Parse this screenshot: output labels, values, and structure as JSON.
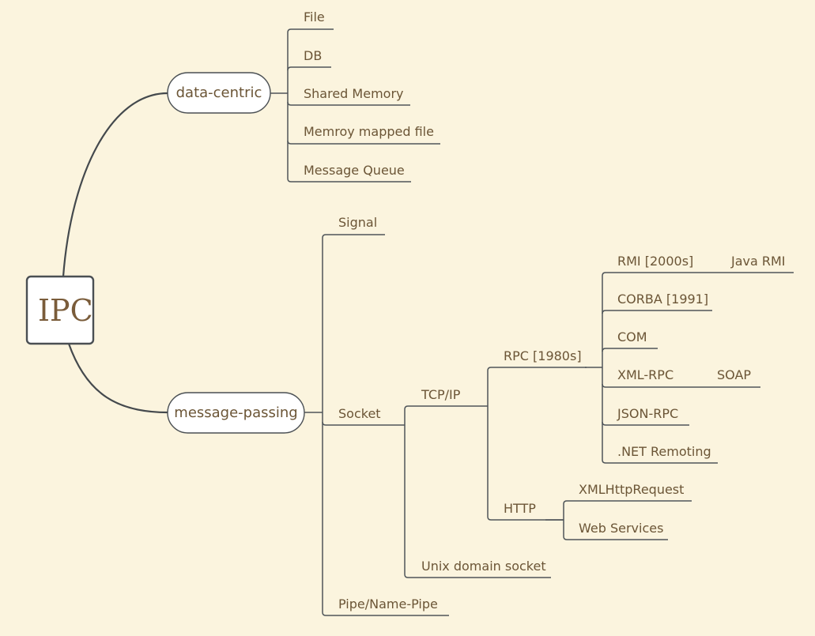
{
  "diagram": {
    "type": "mind-map",
    "background_color": "#fbf4de",
    "line_color": "#4f5559",
    "text_color": "#6b5536",
    "root": {
      "label": "IPC",
      "children": [
        {
          "label": "data-centric",
          "children": [
            {
              "label": "File"
            },
            {
              "label": "DB"
            },
            {
              "label": "Shared Memory"
            },
            {
              "label": "Memroy mapped file"
            },
            {
              "label": "Message Queue"
            }
          ]
        },
        {
          "label": "message-passing",
          "children": [
            {
              "label": "Signal"
            },
            {
              "label": "Socket",
              "children": [
                {
                  "label": "TCP/IP",
                  "children": [
                    {
                      "label": "RPC [1980s]",
                      "children": [
                        {
                          "label": "RMI [2000s]",
                          "children": [
                            {
                              "label": "Java RMI"
                            }
                          ]
                        },
                        {
                          "label": "CORBA [1991]"
                        },
                        {
                          "label": "COM"
                        },
                        {
                          "label": "XML-RPC",
                          "children": [
                            {
                              "label": "SOAP"
                            }
                          ]
                        },
                        {
                          "label": "JSON-RPC"
                        },
                        {
                          "label": ".NET Remoting"
                        }
                      ]
                    },
                    {
                      "label": "HTTP",
                      "children": [
                        {
                          "label": "XMLHttpRequest"
                        },
                        {
                          "label": "Web Services"
                        }
                      ]
                    }
                  ]
                },
                {
                  "label": "Unix domain socket"
                }
              ]
            },
            {
              "label": "Pipe/Name-Pipe"
            }
          ]
        }
      ]
    }
  }
}
